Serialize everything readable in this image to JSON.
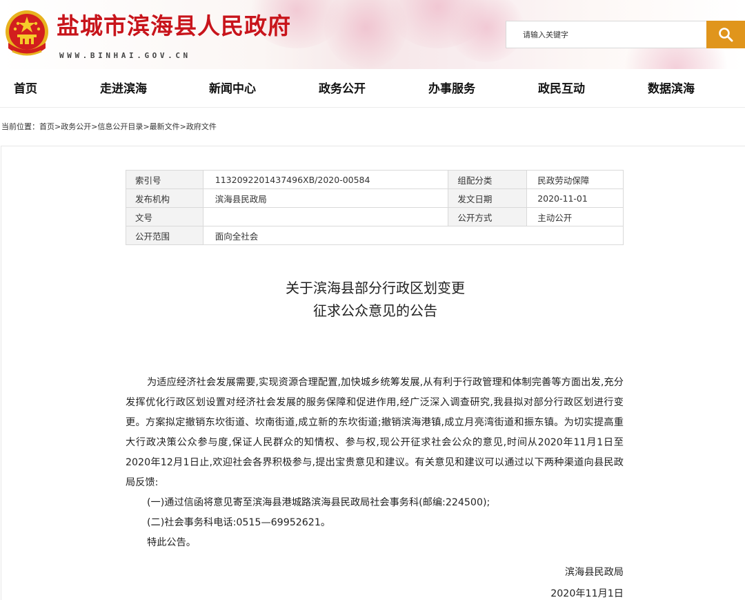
{
  "header": {
    "site_title": "盐城市滨海县人民政府",
    "site_url": "WWW.BINHAI.GOV.CN",
    "emblem_icon": "national-emblem-icon",
    "search_placeholder": "请输入关键字",
    "search_icon": "search-icon",
    "accent_color": "#c8141b",
    "search_button_color": "#e0951c"
  },
  "nav": {
    "items": [
      {
        "label": "首页"
      },
      {
        "label": "走进滨海"
      },
      {
        "label": "新闻中心"
      },
      {
        "label": "政务公开"
      },
      {
        "label": "办事服务"
      },
      {
        "label": "政民互动"
      },
      {
        "label": "数据滨海"
      }
    ]
  },
  "breadcrumb": {
    "prefix": "当前位置：",
    "items": [
      "首页",
      "政务公开",
      "信息公开目录",
      "最新文件",
      "政府文件"
    ],
    "separator": ">"
  },
  "meta": {
    "rows": [
      {
        "label1": "索引号",
        "value1": "1132092201437496XB/2020-00584",
        "label2": "组配分类",
        "value2": "民政劳动保障"
      },
      {
        "label1": "发布机构",
        "value1": "滨海县民政局",
        "label2": "发文日期",
        "value2": "2020-11-01"
      },
      {
        "label1": "文号",
        "value1": "",
        "label2": "公开方式",
        "value2": "主动公开"
      },
      {
        "label1": "公开范围",
        "value1": "面向全社会"
      }
    ]
  },
  "document": {
    "title_line1": "关于滨海县部分行政区划变更",
    "title_line2": "征求公众意见的公告",
    "paragraph1": "为适应经济社会发展需要,实现资源合理配置,加快城乡统筹发展,从有利于行政管理和体制完善等方面出发,充分发挥优化行政区划设置对经济社会发展的服务保障和促进作用,经广泛深入调查研究,我县拟对部分行政区划进行变更。方案拟定撤销东坎街道、坎南街道,成立新的东坎街道;撤销滨海港镇,成立月亮湾街道和振东镇。为切实提高重大行政决策公众参与度,保证人民群众的知情权、参与权,现公开征求社会公众的意见,时间从2020年11月1日至2020年12月1日止,欢迎社会各界积极参与,提出宝贵意见和建议。有关意见和建议可以通过以下两种渠道向县民政局反馈:",
    "item1": "(一)通过信函将意见寄至滨海县港城路滨海县民政局社会事务科(邮编:224500);",
    "item2": "(二)社会事务科电话:0515—69952621。",
    "closing": "特此公告。",
    "signature": "滨海县民政局",
    "date": "2020年11月1日"
  }
}
